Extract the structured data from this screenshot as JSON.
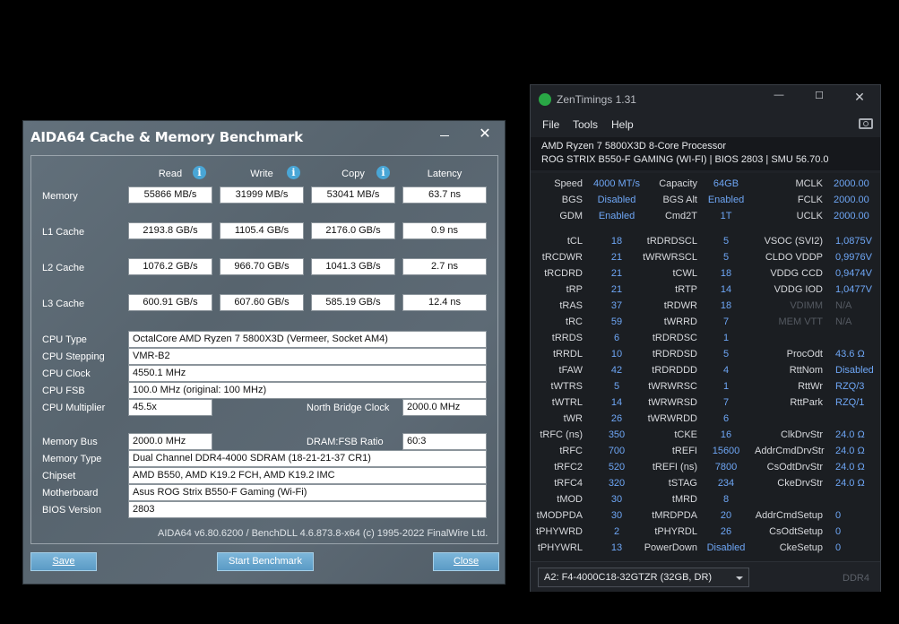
{
  "aida": {
    "title": "AIDA64 Cache & Memory Benchmark",
    "headers": {
      "read": "Read",
      "write": "Write",
      "copy": "Copy",
      "latency": "Latency"
    },
    "rows": [
      {
        "label": "Memory",
        "read": "55866 MB/s",
        "write": "31999 MB/s",
        "copy": "53041 MB/s",
        "latency": "63.7 ns"
      },
      {
        "label": "L1 Cache",
        "read": "2193.8 GB/s",
        "write": "1105.4 GB/s",
        "copy": "2176.0 GB/s",
        "latency": "0.9 ns"
      },
      {
        "label": "L2 Cache",
        "read": "1076.2 GB/s",
        "write": "966.70 GB/s",
        "copy": "1041.3 GB/s",
        "latency": "2.7 ns"
      },
      {
        "label": "L3 Cache",
        "read": "600.91 GB/s",
        "write": "607.60 GB/s",
        "copy": "585.19 GB/s",
        "latency": "12.4 ns"
      }
    ],
    "cpu_type": {
      "label": "CPU Type",
      "value": "OctalCore AMD Ryzen 7 5800X3D  (Vermeer, Socket AM4)"
    },
    "cpu_stepping": {
      "label": "CPU Stepping",
      "value": "VMR-B2"
    },
    "cpu_clock": {
      "label": "CPU Clock",
      "value": "4550.1 MHz"
    },
    "cpu_fsb": {
      "label": "CPU FSB",
      "value": "100.0 MHz  (original: 100 MHz)"
    },
    "cpu_multiplier": {
      "label": "CPU Multiplier",
      "value": "45.5x"
    },
    "nb_clock": {
      "label": "North Bridge Clock",
      "value": "2000.0 MHz"
    },
    "memory_bus": {
      "label": "Memory Bus",
      "value": "2000.0 MHz"
    },
    "dram_fsb": {
      "label": "DRAM:FSB Ratio",
      "value": "60:3"
    },
    "memory_type": {
      "label": "Memory Type",
      "value": "Dual Channel DDR4-4000 SDRAM  (18-21-21-37 CR1)"
    },
    "chipset": {
      "label": "Chipset",
      "value": "AMD B550, AMD K19.2 FCH, AMD K19.2 IMC"
    },
    "motherboard": {
      "label": "Motherboard",
      "value": "Asus ROG Strix B550-F Gaming (Wi-Fi)"
    },
    "bios": {
      "label": "BIOS Version",
      "value": "2803"
    },
    "footer": "AIDA64 v6.80.6200 / BenchDLL 4.6.873.8-x64  (c) 1995-2022 FinalWire Ltd.",
    "buttons": {
      "save": "Save",
      "start": "Start Benchmark",
      "close": "Close"
    }
  },
  "zen": {
    "title": "ZenTimings 1.31",
    "menu": [
      "File",
      "Tools",
      "Help"
    ],
    "cpu": "AMD Ryzen 7 5800X3D 8-Core Processor",
    "board": "ROG STRIX B550-F GAMING (WI-FI) | BIOS 2803 | SMU 56.70.0",
    "top": [
      [
        "Speed",
        "4000 MT/s",
        "Capacity",
        "64GB",
        "MCLK",
        "2000.00"
      ],
      [
        "BGS",
        "Disabled",
        "BGS Alt",
        "Enabled",
        "FCLK",
        "2000.00"
      ],
      [
        "GDM",
        "Enabled",
        "Cmd2T",
        "1T",
        "UCLK",
        "2000.00"
      ]
    ],
    "timings": [
      [
        "tCL",
        "18",
        "tRDRDSCL",
        "5",
        "VSOC (SVI2)",
        "1,0875V"
      ],
      [
        "tRCDWR",
        "21",
        "tWRWRSCL",
        "5",
        "CLDO VDDP",
        "0,9976V"
      ],
      [
        "tRCDRD",
        "21",
        "tCWL",
        "18",
        "VDDG CCD",
        "0,9474V"
      ],
      [
        "tRP",
        "21",
        "tRTP",
        "14",
        "VDDG IOD",
        "1,0477V"
      ],
      [
        "tRAS",
        "37",
        "tRDWR",
        "18",
        "VDIMM",
        "N/A"
      ],
      [
        "tRC",
        "59",
        "tWRRD",
        "7",
        "MEM VTT",
        "N/A"
      ],
      [
        "tRRDS",
        "6",
        "tRDRDSC",
        "1",
        "",
        ""
      ],
      [
        "tRRDL",
        "10",
        "tRDRDSD",
        "5",
        "ProcOdt",
        "43.6 Ω"
      ],
      [
        "tFAW",
        "42",
        "tRDRDDD",
        "4",
        "RttNom",
        "Disabled"
      ],
      [
        "tWTRS",
        "5",
        "tWRWRSC",
        "1",
        "RttWr",
        "RZQ/3"
      ],
      [
        "tWTRL",
        "14",
        "tWRWRSD",
        "7",
        "RttPark",
        "RZQ/1"
      ],
      [
        "tWR",
        "26",
        "tWRWRDD",
        "6",
        "",
        ""
      ],
      [
        "tRFC (ns)",
        "350",
        "tCKE",
        "16",
        "ClkDrvStr",
        "24.0 Ω"
      ],
      [
        "tRFC",
        "700",
        "tREFI",
        "15600",
        "AddrCmdDrvStr",
        "24.0 Ω"
      ],
      [
        "tRFC2",
        "520",
        "tREFI (ns)",
        "7800",
        "CsOdtDrvStr",
        "24.0 Ω"
      ],
      [
        "tRFC4",
        "320",
        "tSTAG",
        "234",
        "CkeDrvStr",
        "24.0 Ω"
      ],
      [
        "tMOD",
        "30",
        "tMRD",
        "8",
        "",
        ""
      ],
      [
        "tMODPDA",
        "30",
        "tMRDPDA",
        "20",
        "AddrCmdSetup",
        "0"
      ],
      [
        "tPHYWRD",
        "2",
        "tPHYRDL",
        "26",
        "CsOdtSetup",
        "0"
      ],
      [
        "tPHYWRL",
        "13",
        "PowerDown",
        "Disabled",
        "CkeSetup",
        "0"
      ]
    ],
    "module": "A2: F4-4000C18-32GTZR (32GB, DR)",
    "ddr": "DDR4"
  }
}
